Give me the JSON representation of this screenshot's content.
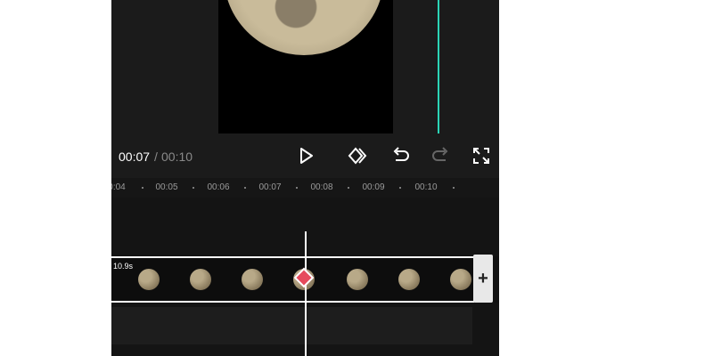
{
  "player": {
    "current_time": "00:07",
    "separator": "/",
    "total_time": "00:10"
  },
  "toolbar": {
    "icons": [
      "play-icon",
      "keyframe-icon",
      "undo-icon",
      "redo-icon",
      "fullscreen-icon"
    ]
  },
  "ruler": {
    "labels": [
      "0:04",
      "00:05",
      "00:06",
      "00:07",
      "00:08",
      "00:09",
      "00:10"
    ]
  },
  "timeline": {
    "clip_duration": "10.9s",
    "add_label": "+"
  },
  "colors": {
    "playhead_preview": "#2bd4b6",
    "keyframe": "#e64a5c",
    "background": "#141414"
  }
}
